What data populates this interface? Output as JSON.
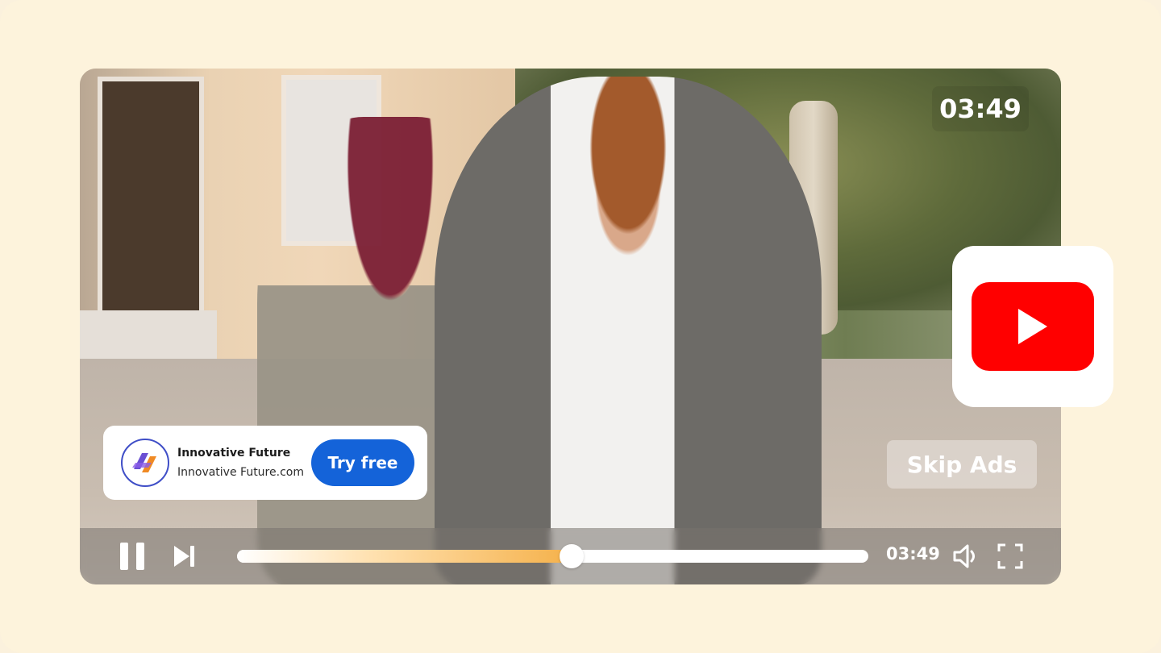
{
  "player": {
    "duration_display": "03:49",
    "current_time": "03:49",
    "progress_fraction": 0.53,
    "skip_label": "Skip Ads"
  },
  "ad": {
    "company_name": "Innovative Future",
    "company_url": "Innovative Future.com",
    "cta_label": "Try free"
  },
  "icons": {
    "pause": "pause-icon",
    "next": "skip-next-icon",
    "volume": "volume-icon",
    "fullscreen": "fullscreen-icon",
    "youtube": "youtube-logo",
    "brand": "innovative-future-logo"
  },
  "colors": {
    "background": "#fdf3dc",
    "cta": "#1463d9",
    "youtube_red": "#ff0000",
    "progress_accent": "#f5b14a"
  }
}
